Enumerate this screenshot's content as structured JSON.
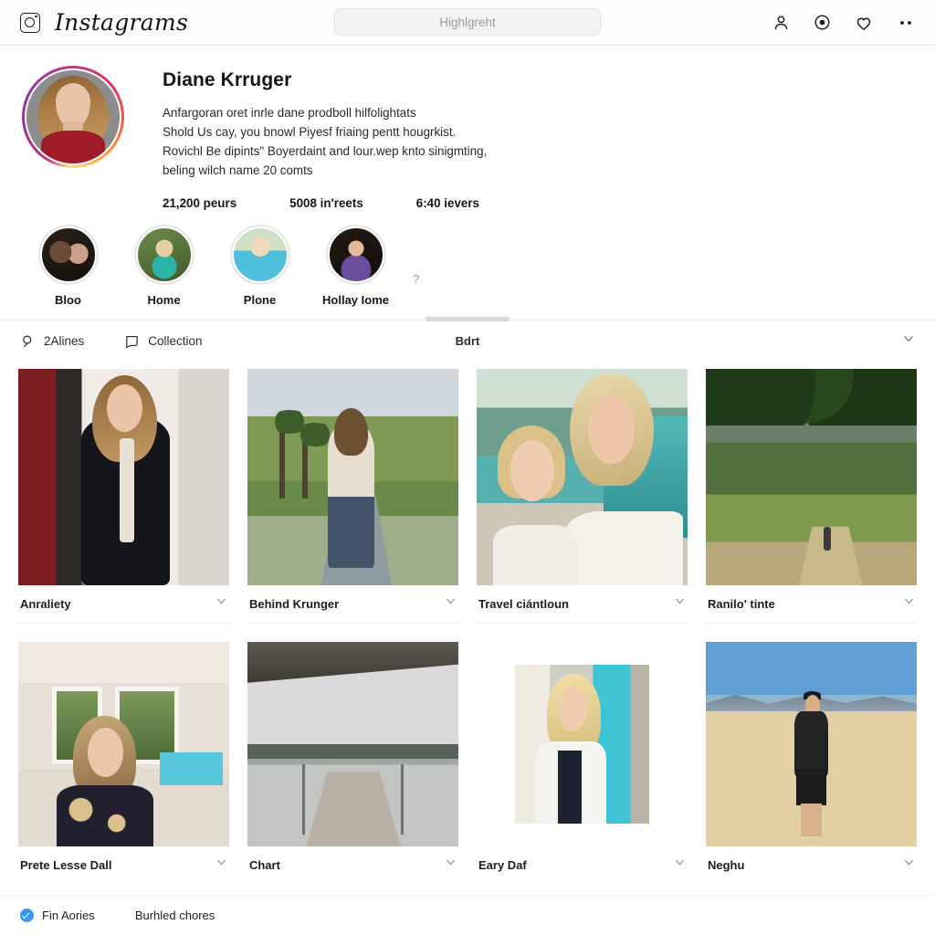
{
  "topnav": {
    "logo_icon": "camera-icon",
    "wordmark": "Instagrams",
    "search": {
      "placeholder": "Highlgreht",
      "value": ""
    },
    "icons": [
      {
        "name": "profile-icon",
        "label": "Profile"
      },
      {
        "name": "explore-icon",
        "label": "Explore"
      },
      {
        "name": "heart-icon",
        "label": "Activity"
      },
      {
        "name": "more-dots-icon",
        "label": "More"
      }
    ]
  },
  "profile": {
    "display_name": "Diane Krruger",
    "bio_lines": [
      "Anfargoran oret inrle dane prodboll hilfolightats",
      "Shold Us cay, you bnowl Piyesf friaing pentt hougrkist.",
      "Rovichl Be dipints\" Boyerdaint and lour.wep knto sinigmting,",
      "beling wilch name 20 comts"
    ],
    "stats": [
      {
        "name": "posts",
        "text": "21,200 peurs"
      },
      {
        "name": "followers",
        "text": "5008 in'reets"
      },
      {
        "name": "following",
        "text": "6:40 ievers"
      }
    ],
    "highlights": [
      {
        "label": "Bloo",
        "thumb": "thumb-bloo"
      },
      {
        "label": "Home",
        "thumb": "thumb-home"
      },
      {
        "label": "Plone",
        "thumb": "thumb-plone"
      },
      {
        "label": "Hollay Iome",
        "thumb": "thumb-hollay"
      }
    ],
    "highlights_more": "?"
  },
  "tabbar": {
    "left_tabs": [
      {
        "label": "2Alines",
        "icon": "tag-person-icon"
      },
      {
        "label": "Collection",
        "icon": "bookmark-chat-icon"
      }
    ],
    "center_label": "Bdrt",
    "right_icon": "chevron-down-icon"
  },
  "grid": {
    "row1": [
      {
        "caption": "Anraliety",
        "scene": "scene-a"
      },
      {
        "caption": "Behind Krunger",
        "scene": "scene-b"
      },
      {
        "caption": "Travel ciántloun",
        "scene": "scene-c"
      },
      {
        "caption": "Ranilo' tinte",
        "scene": "scene-d"
      }
    ],
    "row2": [
      {
        "caption": "Prete Lesse Dall",
        "scene": "scene-e"
      },
      {
        "caption": "Chart",
        "scene": "scene-f"
      },
      {
        "caption": "Eary Daf",
        "scene": "scene-g"
      },
      {
        "caption": "Neghu",
        "scene": "scene-h"
      }
    ]
  },
  "bottombar": {
    "items": [
      {
        "label": "Fin Aories",
        "verified": true
      },
      {
        "label": "Burhled chores",
        "verified": false
      }
    ]
  },
  "colors": {
    "verified_blue": "#3897f0",
    "page_bg": "#ffffff",
    "border": "#ededed",
    "text": "#1e1e1e",
    "muted": "#9a9a9a"
  }
}
